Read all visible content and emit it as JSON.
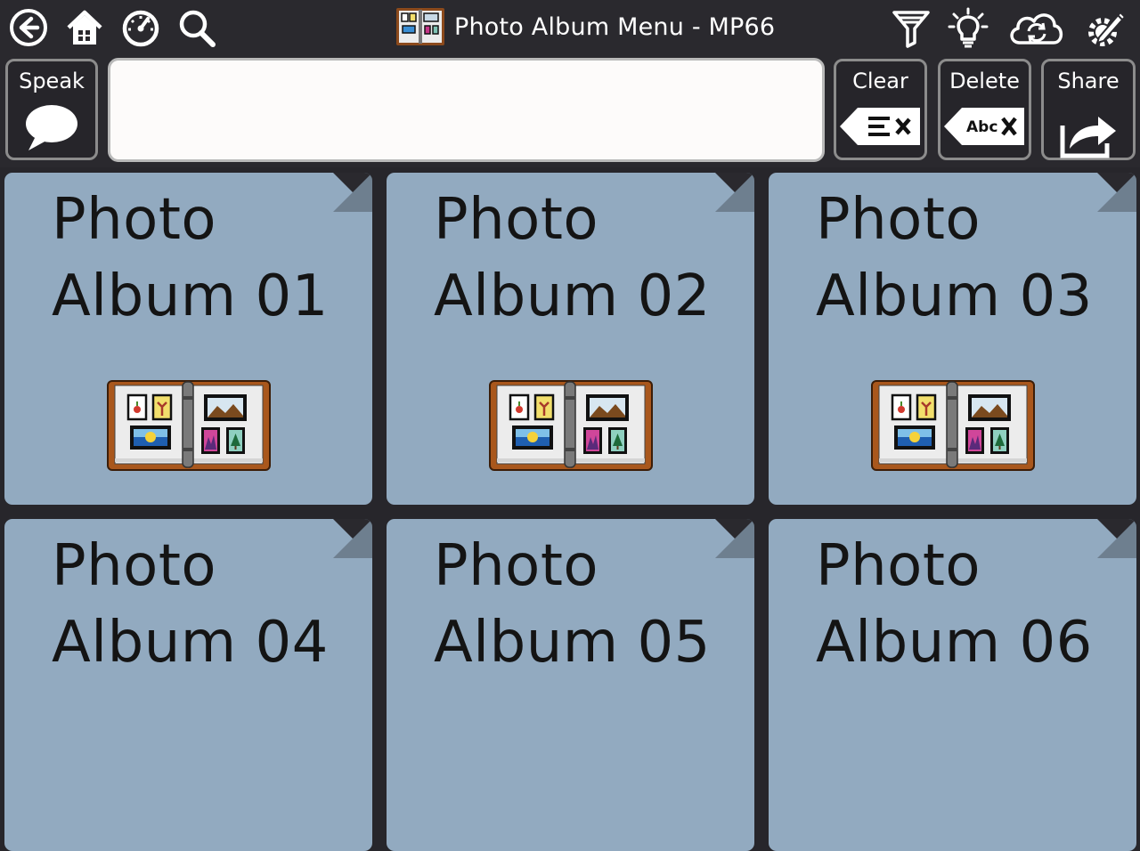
{
  "topbar": {
    "title": "Photo Album Menu - MP66",
    "left_icons": [
      "back-icon",
      "home-icon",
      "dashboard-icon",
      "search-icon"
    ],
    "right_icons": [
      "filter-icon",
      "lightbulb-icon",
      "cloud-sync-icon",
      "edit-settings-icon"
    ]
  },
  "message_bar": {
    "speak_label": "Speak",
    "clear_label": "Clear",
    "delete_label": "Delete",
    "share_label": "Share",
    "text": ""
  },
  "grid": {
    "cells": [
      {
        "line1": "Photo",
        "line2": "Album 01"
      },
      {
        "line1": "Photo",
        "line2": "Album 02"
      },
      {
        "line1": "Photo",
        "line2": "Album 03"
      },
      {
        "line1": "Photo",
        "line2": "Album 04"
      },
      {
        "line1": "Photo",
        "line2": "Album 05"
      },
      {
        "line1": "Photo",
        "line2": "Album 06"
      }
    ]
  },
  "colors": {
    "background": "#27262b",
    "cell": "#92aac0",
    "textbox": "#fdfbfa",
    "album_cover": "#a9571c"
  },
  "delete_icon_text": "Abc"
}
